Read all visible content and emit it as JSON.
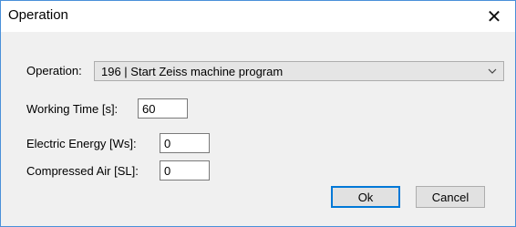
{
  "window": {
    "title": "Operation",
    "close_glyph": "✕"
  },
  "operation": {
    "label": "Operation:",
    "selected": "196 | Start Zeiss machine program",
    "arrow_icon": "chevron-down-icon"
  },
  "working_time": {
    "label": "Working Time [s]:",
    "value": "60"
  },
  "electric_energy": {
    "label": "Electric Energy [Ws]:",
    "value": "0"
  },
  "compressed_air": {
    "label": "Compressed Air [SL]:",
    "value": "0"
  },
  "buttons": {
    "ok": "Ok",
    "cancel": "Cancel"
  },
  "colors": {
    "accent": "#0078d7",
    "window_border": "#4a90d9",
    "client_bg": "#f0f0f0"
  }
}
